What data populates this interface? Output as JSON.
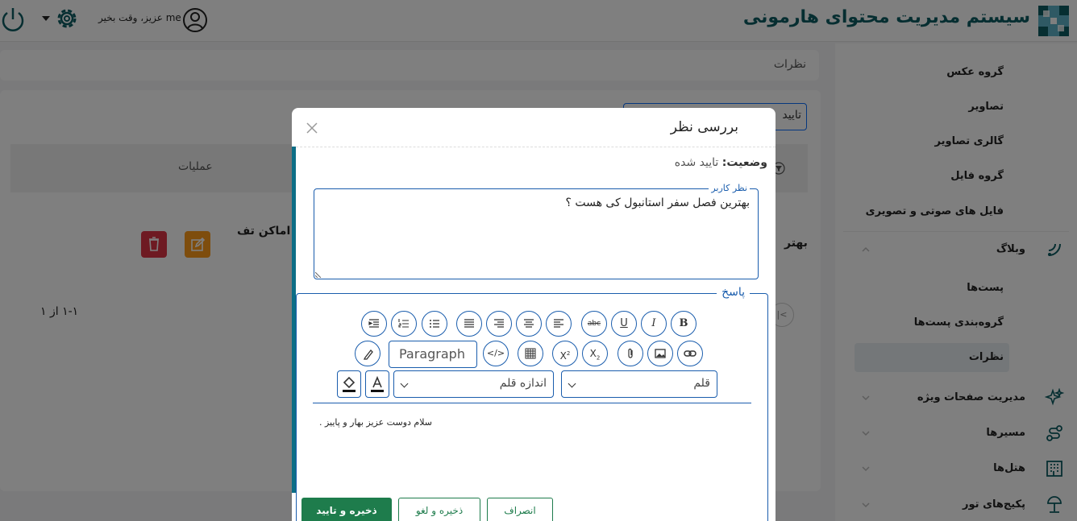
{
  "app": {
    "title": "سیستم مدیریت محتوای هارمونی",
    "greeting": "me عزیز، وقت بخیر"
  },
  "sidebar": {
    "sub_items": [
      "گروه عکس",
      "تصاویر",
      "گالری تصاویر",
      "گروه فایل",
      "فایل های صوتی و تصویری"
    ],
    "weblog": {
      "label": "وبلاگ",
      "sub_items": [
        "پست‌ها",
        "گروه‌بندی پست‌ها",
        "نظرات"
      ]
    },
    "groups": [
      "مدیریت صفحات ویژه",
      "مسیرها",
      "هتل‌ها",
      "پکیج‌های تور"
    ]
  },
  "main": {
    "breadcrumb": "نظرات",
    "status_filter": "تایید",
    "table_header_ops": "عملیات",
    "row_text": "ین اماکن تف",
    "row_text2": "بهتر",
    "pagination": "۱-۱ از ۱"
  },
  "modal": {
    "title": "بررسی نظر",
    "status_label": "وضعیت:",
    "status_value": "تایید شده",
    "user_comment_legend": "نظر کاربر",
    "user_comment": "بهترین فصل سفر استانبول کی هست ؟",
    "reply_legend": "پاسخ",
    "paragraph": "Paragraph",
    "font_label": "قلم",
    "font_size_label": "اندازه قلم",
    "editor_text": "سلام دوست عزیز بهار و پاییز .",
    "buttons": {
      "cancel": "انصراف",
      "save_reject": "ذخیره و لغو",
      "save_approve": "ذخیره و تایید"
    }
  },
  "colors": {
    "brand": "#0d5c63",
    "accent": "#1a5dad",
    "green": "#1e7c4c",
    "danger": "#dc3545",
    "warning": "#fd9a1a"
  }
}
